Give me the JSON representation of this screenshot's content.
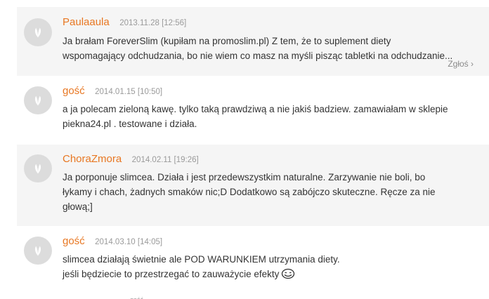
{
  "comments": [
    {
      "author": "Paulaaula",
      "date": "2013.11.28 [12:56]",
      "lines": [
        "Ja brałam ForeverSlim (kupiłam na promoslim.pl) Z tem, że to suplement diety",
        "wspomagający odchudzania, bo nie wiem co masz na myśli pisząc tabletki na odchudzanie..."
      ],
      "report_label": "Zgłoś ›"
    },
    {
      "author": "gość",
      "date": "2014.01.15 [10:50]",
      "lines": [
        "a ja polecam zieloną kawę. tylko taką prawdziwą a nie jakiś badziew. zamawiałam w sklepie",
        "piekna24.pl . testowane i działa."
      ]
    },
    {
      "author": "ChoraZmora",
      "date": "2014.02.11 [19:26]",
      "lines": [
        "Ja porponuje slimcea. Działa i jest przedewszystkim naturalne. Zarzywanie nie boli, bo",
        "łykamy i chach, żadnych smaków nic;D Dodatkowo są zabójczo skuteczne. Ręcze za nie",
        "głową;]"
      ]
    },
    {
      "author": "gość",
      "date": "2014.03.10 [14:05]",
      "lines": [
        "slimcea działają świetnie ale POD WARUNKIEM utrzymania diety.",
        "jeśli będziecie to przestrzegać to zauważycie efekty"
      ],
      "emoticon": "smiley-icon"
    }
  ],
  "next_comment_partial": "gość"
}
